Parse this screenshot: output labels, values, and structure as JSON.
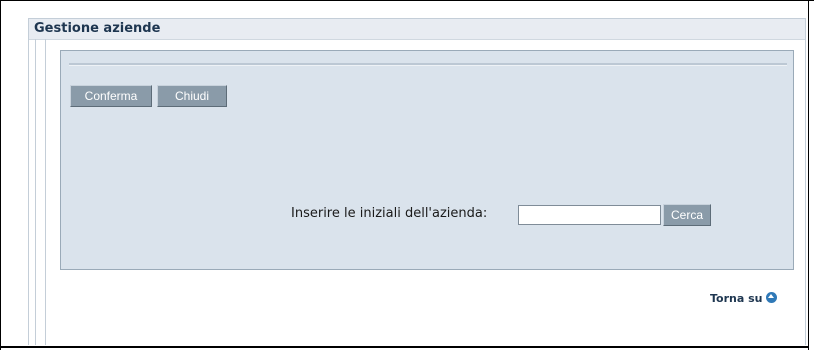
{
  "panel": {
    "title": "Gestione aziende"
  },
  "toolbar": {
    "confirm_label": "Conferma",
    "close_label": "Chiudi"
  },
  "search": {
    "label": "Inserire le iniziali dell'azienda:",
    "value": "",
    "placeholder": "",
    "button_label": "Cerca"
  },
  "footer": {
    "back_to_top_label": "Torna su",
    "back_to_top_icon": "arrow-up-circle-icon"
  },
  "colors": {
    "title_text": "#1e3650",
    "form_background": "#dae3ec",
    "button_background": "#8a9ba9",
    "icon_blue": "#2f79b7"
  }
}
